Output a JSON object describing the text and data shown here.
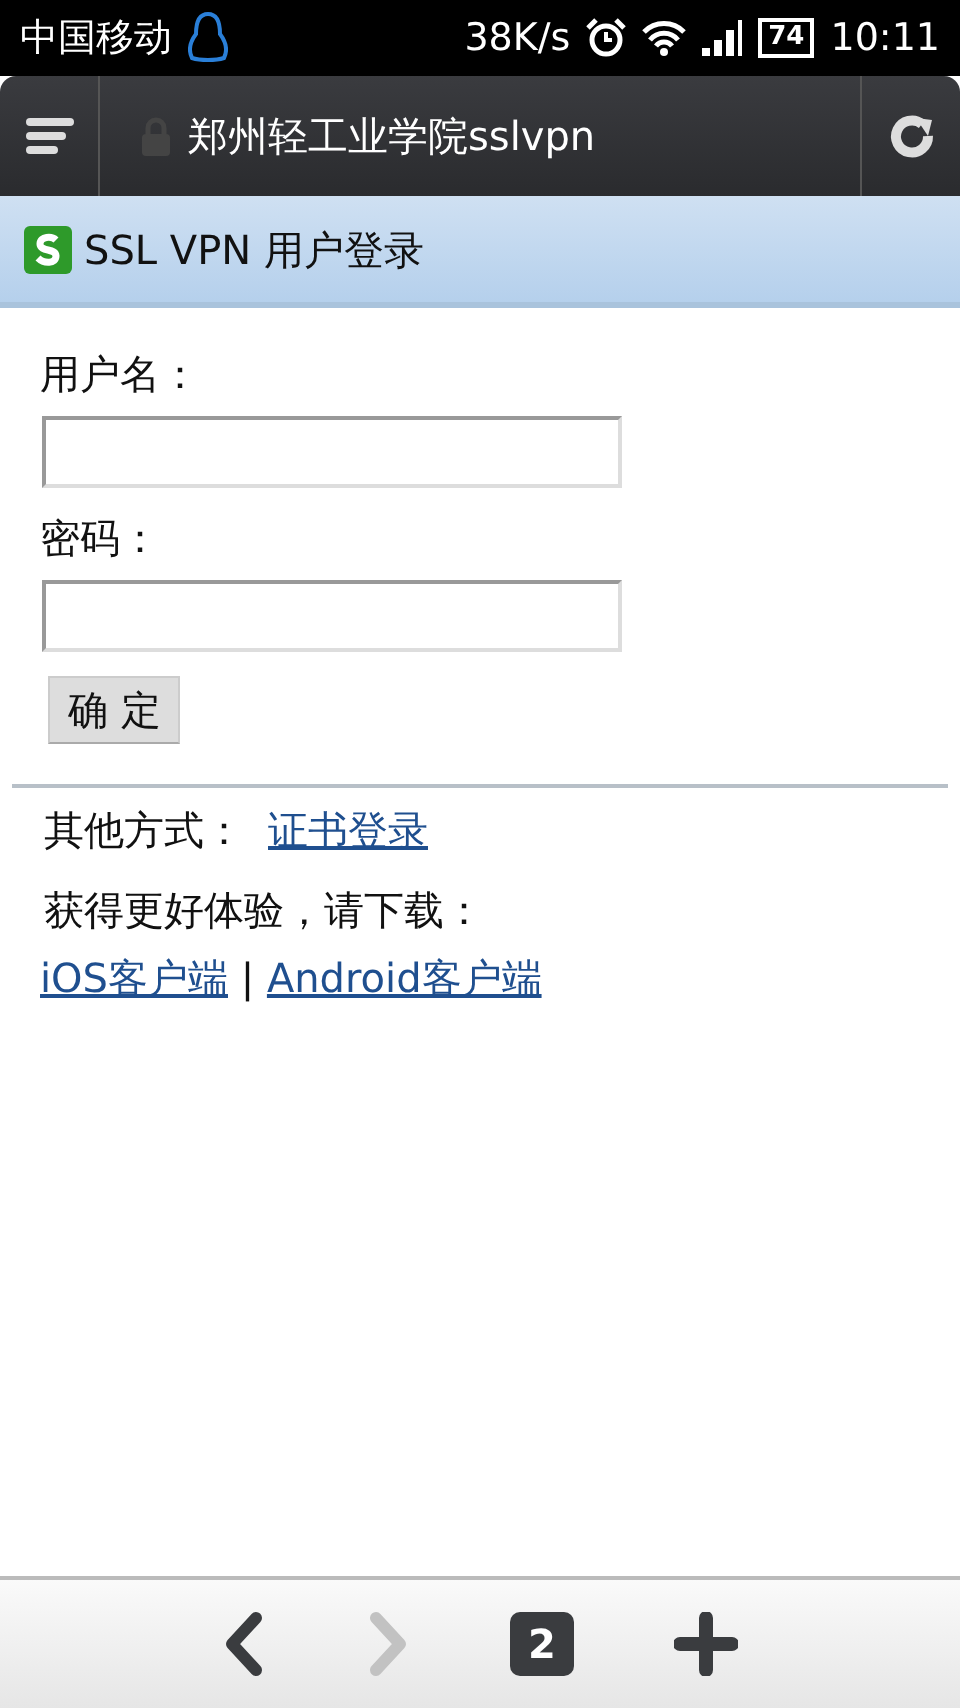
{
  "status_bar": {
    "carrier": "中国移动",
    "speed": "38K/s",
    "battery": "74",
    "time": "10:11"
  },
  "address_bar": {
    "title": "郑州轻工业学院sslvpn"
  },
  "header": {
    "title": "SSL VPN 用户登录"
  },
  "form": {
    "fields": [
      {
        "label": "用户名："
      },
      {
        "label": "密码："
      }
    ],
    "submit": "确 定"
  },
  "other": {
    "label": "其他方式：",
    "link": "证书登录"
  },
  "download": {
    "text": "获得更好体验，请下载：",
    "links": [
      "iOS客户端",
      "Android客户端"
    ],
    "separator": "|"
  },
  "toolbar": {
    "back": {
      "disabled": false
    },
    "forward": {
      "disabled": true
    },
    "tabs": "2"
  }
}
